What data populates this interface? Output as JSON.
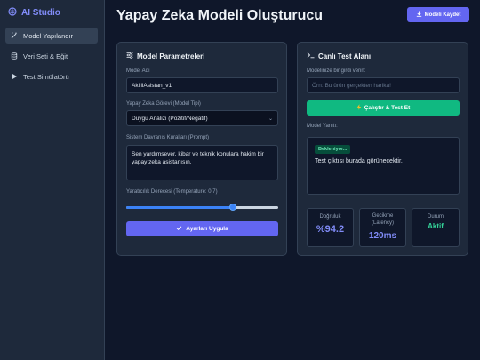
{
  "app": {
    "name": "AI Studio",
    "brand_color": "#818cf8"
  },
  "sidebar": {
    "items": [
      {
        "label": "Model Yapılandır",
        "icon": "magic-wand-icon",
        "active": true
      },
      {
        "label": "Veri Seti & Eğit",
        "icon": "database-icon",
        "active": false
      },
      {
        "label": "Test Simülatörü",
        "icon": "play-icon",
        "active": false
      }
    ]
  },
  "header": {
    "title": "Yapay Zeka Modeli Oluşturucu",
    "save_label": "Modeli Kaydet"
  },
  "params": {
    "title": "Model Parametreleri",
    "model_name_label": "Model Adı",
    "model_name_value": "AkilliAsistan_v1",
    "task_label": "Yapay Zeka Görevi (Model Tipi)",
    "task_value": "Duygu Analizi (Pozitif/Negatif)",
    "prompt_label": "Sistem Davranış Kuralları (Prompt)",
    "prompt_value": "Sen yardımsever, kibar ve teknik konulara hakim bir yapay zeka asistanısın.",
    "temperature_label": "Yaratıcılık Derecesi (Temperature: 0.7)",
    "temperature_value": 0.7,
    "apply_label": "Ayarları Uygula"
  },
  "test": {
    "title": "Canlı Test Alanı",
    "input_label": "Modelinize bir girdi verin:",
    "input_placeholder": "Örn: Bu ürün gerçekten harika!",
    "run_label": "Çalıştır & Test Et",
    "response_label": "Model Yanıtı:",
    "status_badge": "Bekleniyor...",
    "output_text": "Test çıktısı burada görünecektir."
  },
  "metrics": [
    {
      "label": "Doğruluk",
      "value": "%94.2",
      "color": "#818cf8"
    },
    {
      "label": "Gecikme (Latency)",
      "value": "120ms",
      "color": "#818cf8"
    },
    {
      "label": "Durum",
      "value": "Aktif",
      "color": "#34d399"
    }
  ],
  "colors": {
    "accent": "#6366f1",
    "success": "#10b981",
    "background": "#0f172a",
    "panel": "#1e293b"
  }
}
